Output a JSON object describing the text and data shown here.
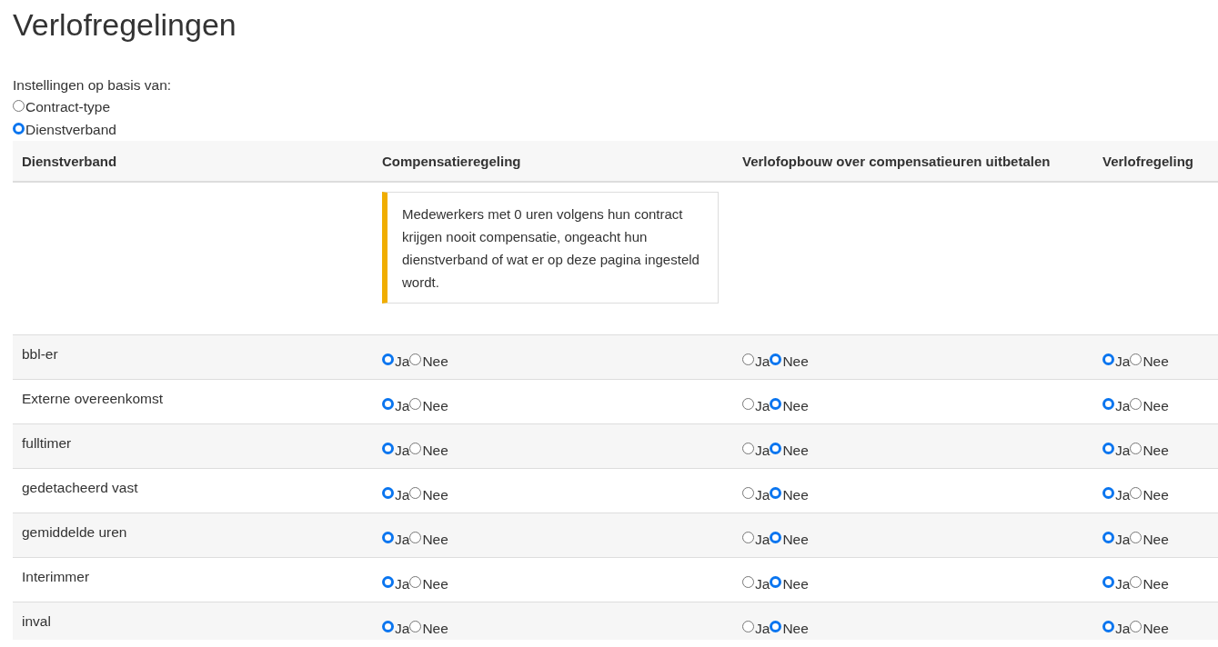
{
  "title": "Verlofregelingen",
  "settings": {
    "label": "Instellingen op basis van:",
    "options": [
      {
        "label": "Contract-type",
        "selected": false
      },
      {
        "label": "Dienstverband",
        "selected": true
      }
    ]
  },
  "table": {
    "columns": [
      "Dienstverband",
      "Compensatieregeling",
      "Verlofopbouw over compensatieuren uitbetalen",
      "Verlofregeling"
    ],
    "notice": "Medewerkers met 0 uren volgens hun contract krijgen nooit compensatie, ongeacht hun dienstverband of wat er op deze pagina ingesteld wordt.",
    "rows": [
      {
        "name": "bbl-er",
        "groups": [
          [
            {
              "label": "Ja",
              "selected": true
            },
            {
              "label": "Nee",
              "selected": false
            }
          ],
          [
            {
              "label": "Ja",
              "selected": false
            },
            {
              "label": "Nee",
              "selected": true
            }
          ],
          [
            {
              "label": "Ja",
              "selected": true
            },
            {
              "label": "Nee",
              "selected": false
            }
          ]
        ]
      },
      {
        "name": "Externe overeenkomst",
        "groups": [
          [
            {
              "label": "Ja",
              "selected": true
            },
            {
              "label": "Nee",
              "selected": false
            }
          ],
          [
            {
              "label": "Ja",
              "selected": false
            },
            {
              "label": "Nee",
              "selected": true
            }
          ],
          [
            {
              "label": "Ja",
              "selected": true
            },
            {
              "label": "Nee",
              "selected": false
            }
          ]
        ]
      },
      {
        "name": "fulltimer",
        "groups": [
          [
            {
              "label": "Ja",
              "selected": true
            },
            {
              "label": "Nee",
              "selected": false
            }
          ],
          [
            {
              "label": "Ja",
              "selected": false
            },
            {
              "label": "Nee",
              "selected": true
            }
          ],
          [
            {
              "label": "Ja",
              "selected": true
            },
            {
              "label": "Nee",
              "selected": false
            }
          ]
        ]
      },
      {
        "name": "gedetacheerd vast",
        "groups": [
          [
            {
              "label": "Ja",
              "selected": true
            },
            {
              "label": "Nee",
              "selected": false
            }
          ],
          [
            {
              "label": "Ja",
              "selected": false
            },
            {
              "label": "Nee",
              "selected": true
            }
          ],
          [
            {
              "label": "Ja",
              "selected": true
            },
            {
              "label": "Nee",
              "selected": false
            }
          ]
        ]
      },
      {
        "name": "gemiddelde uren",
        "groups": [
          [
            {
              "label": "Ja",
              "selected": true
            },
            {
              "label": "Nee",
              "selected": false
            }
          ],
          [
            {
              "label": "Ja",
              "selected": false
            },
            {
              "label": "Nee",
              "selected": true
            }
          ],
          [
            {
              "label": "Ja",
              "selected": true
            },
            {
              "label": "Nee",
              "selected": false
            }
          ]
        ]
      },
      {
        "name": "Interimmer",
        "groups": [
          [
            {
              "label": "Ja",
              "selected": true
            },
            {
              "label": "Nee",
              "selected": false
            }
          ],
          [
            {
              "label": "Ja",
              "selected": false
            },
            {
              "label": "Nee",
              "selected": true
            }
          ],
          [
            {
              "label": "Ja",
              "selected": true
            },
            {
              "label": "Nee",
              "selected": false
            }
          ]
        ]
      },
      {
        "name": "inval",
        "groups": [
          [
            {
              "label": "Ja",
              "selected": true
            },
            {
              "label": "Nee",
              "selected": false
            }
          ],
          [
            {
              "label": "Ja",
              "selected": false
            },
            {
              "label": "Nee",
              "selected": true
            }
          ],
          [
            {
              "label": "Ja",
              "selected": true
            },
            {
              "label": "Nee",
              "selected": false
            }
          ]
        ]
      }
    ]
  }
}
